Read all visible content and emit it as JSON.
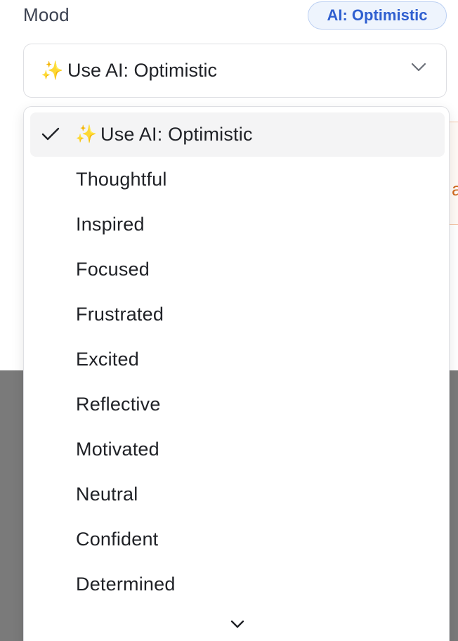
{
  "field": {
    "label": "Mood",
    "ai_badge": "AI: Optimistic"
  },
  "select": {
    "sparkle": "✨",
    "value": "Use AI: Optimistic"
  },
  "dropdown": {
    "selected_index": 0,
    "options": [
      {
        "icon": "✨",
        "label": "Use AI: Optimistic"
      },
      {
        "label": "Thoughtful"
      },
      {
        "label": "Inspired"
      },
      {
        "label": "Focused"
      },
      {
        "label": "Frustrated"
      },
      {
        "label": "Excited"
      },
      {
        "label": "Reflective"
      },
      {
        "label": "Motivated"
      },
      {
        "label": "Neutral"
      },
      {
        "label": "Confident"
      },
      {
        "label": "Determined"
      }
    ]
  },
  "background": {
    "partial_text": "a"
  },
  "colors": {
    "badge_text": "#2f5fd0",
    "badge_bg": "#eef4fd",
    "sparkle": "#f3c24b",
    "overlay": "#7a7a7a"
  }
}
